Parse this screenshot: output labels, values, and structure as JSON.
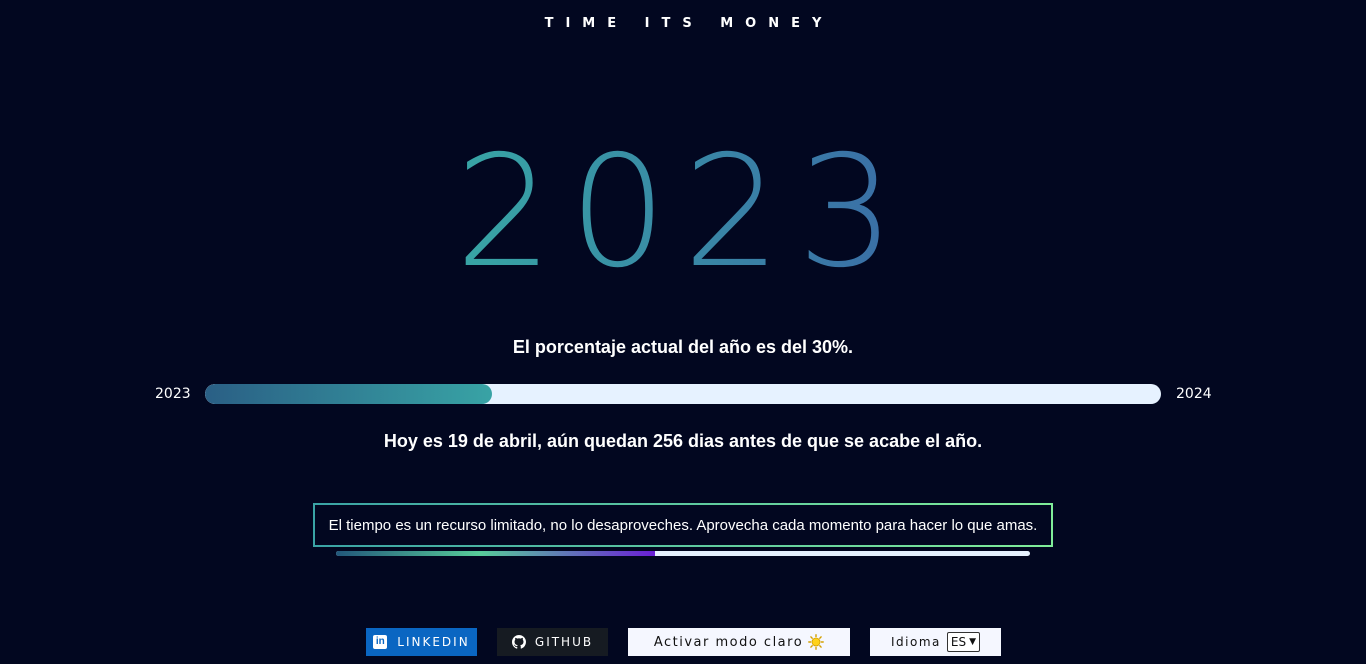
{
  "header": {
    "brand": "TIME ITS MONEY"
  },
  "hero": {
    "year": "2023"
  },
  "progress": {
    "percent_text": "El porcentaje actual del año es del 30%.",
    "start_label": "2023",
    "end_label": "2024",
    "value_percent": 30
  },
  "today": {
    "text": "Hoy es 19 de abril, aún quedan 256 dias antes de que se acabe el año."
  },
  "quote": {
    "text": "El tiempo es un recurso limitado, no lo desaproveches. Aprovecha cada momento para hacer lo que amas.",
    "timer_percent": 46
  },
  "footer": {
    "linkedin_label": "LINKEDIN",
    "linkedin_icon_text": "in",
    "github_label": "GITHUB",
    "light_mode_label": "Activar modo claro",
    "language_label": "Idioma",
    "language_value": "ES"
  },
  "colors": {
    "background": "#020720",
    "accent_teal": "#38a3a5",
    "accent_blue": "#3a6fa6",
    "linkedin": "#0a66c2",
    "github": "#161b22"
  },
  "icons": {
    "linkedin": "linkedin-icon",
    "github": "github-icon",
    "light_mode": "sun-icon",
    "language_dropdown": "chevron-down-icon"
  }
}
